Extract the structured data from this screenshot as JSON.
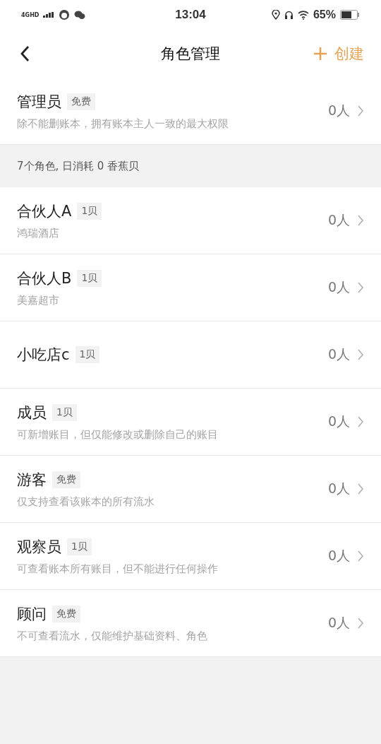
{
  "status_bar": {
    "network": "4GHD",
    "time": "13:04",
    "battery": "65%"
  },
  "nav": {
    "title": "角色管理",
    "action": "创建"
  },
  "admin": {
    "name": "管理员",
    "tag": "免费",
    "desc": "除不能删账本，拥有账本主人一致的最大权限",
    "count": "0人"
  },
  "summary": "7个角色, 日消耗 0 香蕉贝",
  "roles": [
    {
      "name": "合伙人A",
      "tag": "1贝",
      "desc": "鸿瑞酒店",
      "count": "0人"
    },
    {
      "name": "合伙人B",
      "tag": "1贝",
      "desc": "美嘉超市",
      "count": "0人"
    },
    {
      "name": "小吃店c",
      "tag": "1贝",
      "count": "0人"
    },
    {
      "name": "成员",
      "tag": "1贝",
      "desc": "可新增账目，但仅能修改或删除自己的账目",
      "count": "0人"
    },
    {
      "name": "游客",
      "tag": "免费",
      "desc": "仅支持查看该账本的所有流水",
      "count": "0人"
    },
    {
      "name": "观察员",
      "tag": "1贝",
      "desc": "可查看账本所有账目，但不能进行任何操作",
      "count": "0人"
    },
    {
      "name": "顾问",
      "tag": "免费",
      "desc": "不可查看流水，仅能维护基础资料、角色",
      "count": "0人"
    }
  ]
}
